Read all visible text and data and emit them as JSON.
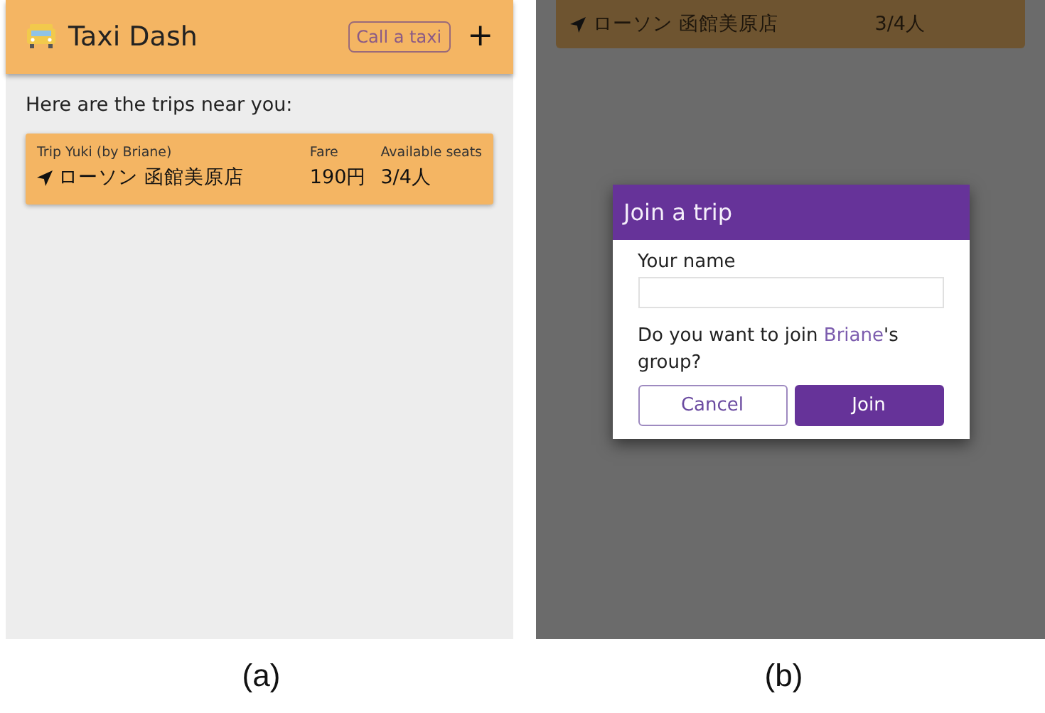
{
  "panel_a": {
    "app_bar": {
      "title": "Taxi Dash",
      "call_button": "Call a taxi",
      "add_button": "+"
    },
    "intro": "Here are the trips near you:",
    "trips": [
      {
        "name": "Trip Yuki (by Briane)",
        "place": "ローソン 函館美原店",
        "fare_label": "Fare",
        "fare": "190円",
        "seats_label": "Available seats",
        "seats": "3/4人"
      }
    ],
    "caption": "(a)"
  },
  "panel_b": {
    "trip_peek": {
      "place": "ローソン 函館美原店",
      "seats": "3/4人"
    },
    "dialog": {
      "title": "Join a trip",
      "name_label": "Your name",
      "question_before": "Do you want to join ",
      "question_link": "Briane",
      "question_after": "'s group?",
      "buttons": [
        {
          "label": "Cancel",
          "kind": "secondary"
        },
        {
          "label": "Join",
          "kind": "primary"
        }
      ]
    },
    "caption": "(b)"
  }
}
